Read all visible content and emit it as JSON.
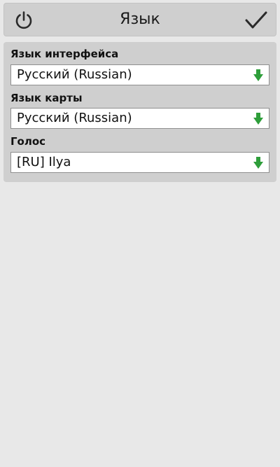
{
  "header": {
    "title": "Язык",
    "left_icon": "power-icon",
    "right_icon": "checkmark-icon"
  },
  "settings": [
    {
      "label": "Язык интерфейса",
      "value": "Русский (Russian)"
    },
    {
      "label": "Язык карты",
      "value": "Русский (Russian)"
    },
    {
      "label": "Голос",
      "value": "[RU] Ilya"
    }
  ],
  "colors": {
    "arrow": "#2e9e3a",
    "bar": "#cfcfcf",
    "background": "#e8e8e8"
  }
}
